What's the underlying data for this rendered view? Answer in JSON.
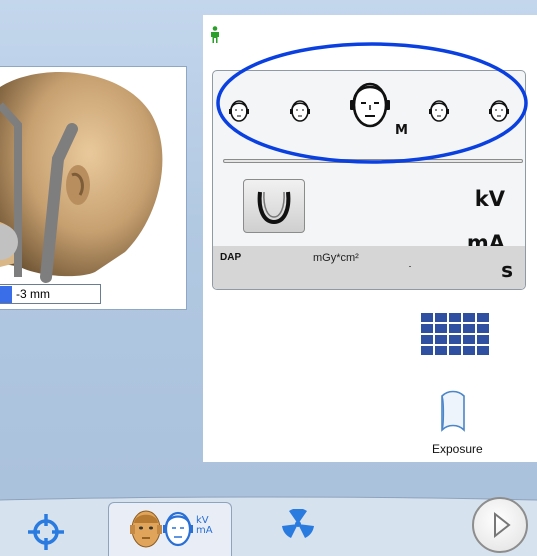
{
  "left_preview": {
    "offset_field_value": "-3 mm"
  },
  "panel": {
    "face_selector": {
      "selected_size_label": "M",
      "sizes": [
        "XS",
        "S",
        "M",
        "L",
        "XL"
      ]
    },
    "units": {
      "kv": "kV",
      "ma": "mA",
      "seconds": "s"
    },
    "dap": {
      "label": "DAP",
      "unit": "mGy*cm²"
    },
    "exposure_label": "Exposure"
  },
  "bottom_bar": {
    "kvma_label_line1": "kV",
    "kvma_label_line2": "mA"
  },
  "colors": {
    "accent_blue": "#0a3fe0",
    "icon_blue": "#2a6fd6",
    "grid_blue": "#2f4fa0",
    "person_green": "#2aa02a"
  },
  "icons": [
    "person-icon",
    "face-icon",
    "arch-icon",
    "grid-icon",
    "exposure-icon",
    "crosshair-icon",
    "radiation-icon",
    "play-icon"
  ]
}
